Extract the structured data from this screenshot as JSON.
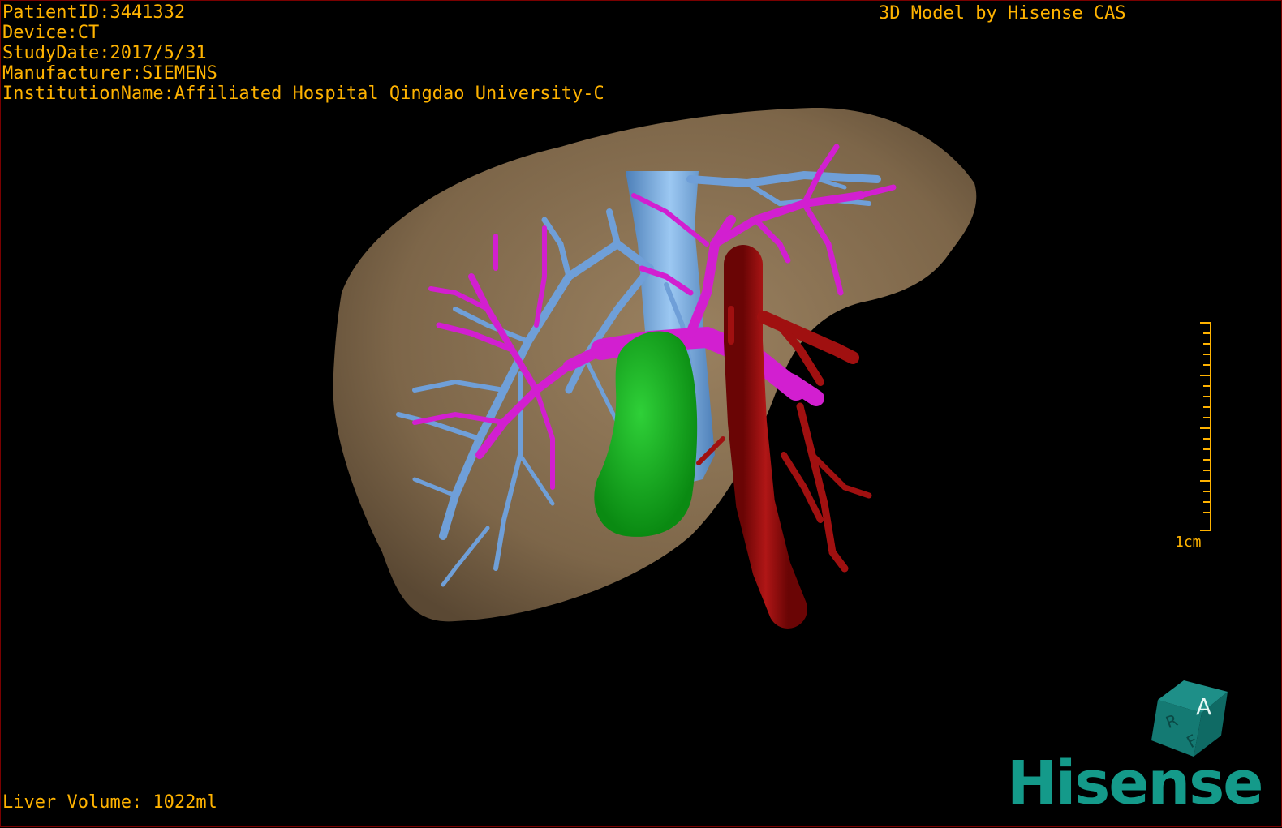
{
  "info": {
    "patient_id": "PatientID:3441332",
    "device": "Device:CT",
    "study_date": "StudyDate:2017/5/31",
    "manufacturer": "Manufacturer:SIEMENS",
    "institution": "InstitutionName:Affiliated Hospital Qingdao University-C"
  },
  "header": {
    "model_by": "3D Model by Hisense CAS"
  },
  "footer": {
    "liver_volume": "Liver Volume: 1022ml"
  },
  "scale_bar": {
    "label": "1cm"
  },
  "orientation_cube": {
    "label_a": "A",
    "label_r": "R",
    "label_f": "F"
  },
  "logo": {
    "text": "Hisense"
  },
  "colors": {
    "overlay_text": "#ffb300",
    "liver": "#8a7253",
    "portal_vein": "#d21fd0",
    "hepatic_vein": "#6f9fd8",
    "artery": "#9a0b0b",
    "tumor": "#12b21b",
    "ivc": "#7eb6ec",
    "logo": "#149a8a"
  }
}
